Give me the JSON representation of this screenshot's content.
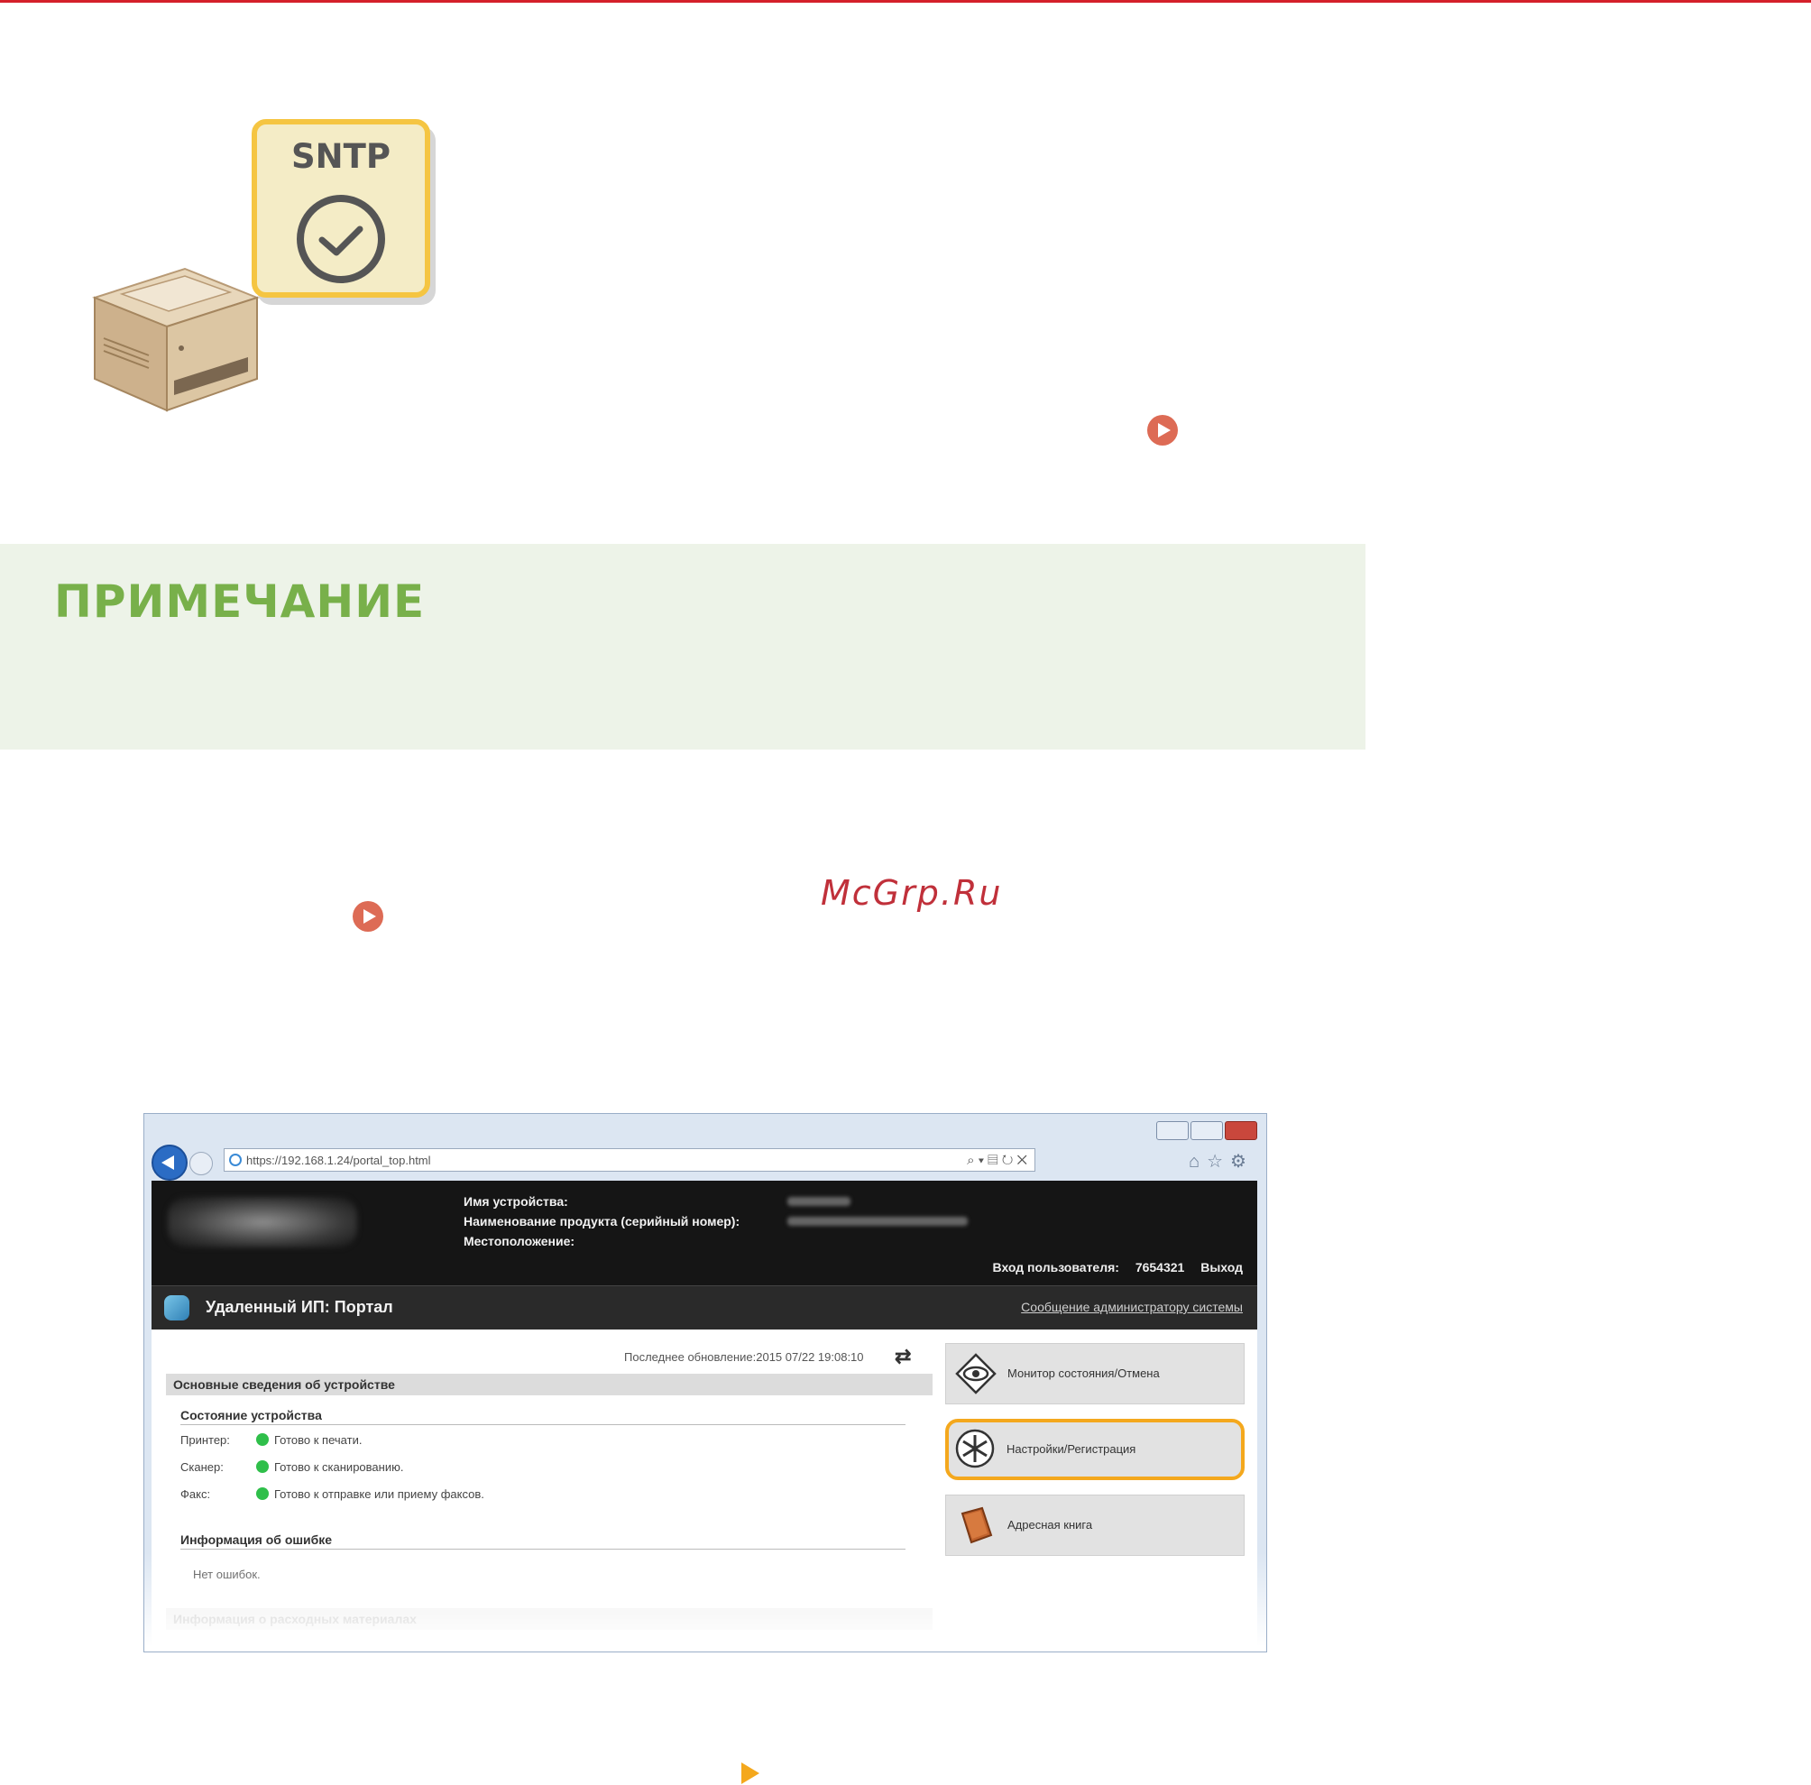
{
  "illustration": {
    "sntp_label": "SNTP"
  },
  "note": {
    "title": "ПРИМЕЧАНИЕ"
  },
  "watermark": "McGrp.Ru",
  "screenshot": {
    "address": "https://192.168.1.24/portal_top.html",
    "address_tools": "⌕ ▾ ▤ ↻ ✕",
    "nav_icons": "⌂☆⚙",
    "device_info": {
      "name_label": "Имя устройства:",
      "product_label": "Наименование продукта (серийный номер):",
      "location_label": "Местоположение:"
    },
    "login": {
      "label": "Вход пользователя:",
      "user_id": "7654321",
      "logout": "Выход"
    },
    "title": "Удаленный ИП: Портал",
    "admin_link": "Сообщение администратору системы",
    "last_updated": "Последнее обновление:2015 07/22 19:08:10",
    "basic_info": {
      "heading": "Основные сведения об устройстве",
      "status_heading": "Состояние устройства",
      "rows": [
        {
          "key": "Принтер:",
          "value": "Готово к печати."
        },
        {
          "key": "Сканер:",
          "value": "Готово к сканированию."
        },
        {
          "key": "Факс:",
          "value": "Готово к отправке или приему факсов."
        }
      ],
      "error_heading": "Информация об ошибке",
      "error_text": "Нет ошибок.",
      "consumables_heading": "Информация о расходных материалах"
    },
    "menu": [
      {
        "label": "Монитор состояния/Отмена"
      },
      {
        "label": "Настройки/Регистрация"
      },
      {
        "label": "Адресная книга"
      }
    ]
  }
}
